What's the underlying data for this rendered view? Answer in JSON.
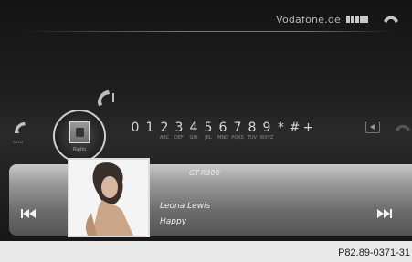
{
  "status": {
    "carrier": "Vodafone.de",
    "signal_bars": 5
  },
  "dialpad": {
    "selected_button_label": "Radio",
    "keys": [
      {
        "char": "0",
        "sub": ""
      },
      {
        "char": "1",
        "sub": ""
      },
      {
        "char": "2",
        "sub": "ABC"
      },
      {
        "char": "3",
        "sub": "DEF"
      },
      {
        "char": "4",
        "sub": "GHI"
      },
      {
        "char": "5",
        "sub": "JKL"
      },
      {
        "char": "6",
        "sub": "MNO"
      },
      {
        "char": "7",
        "sub": "PQRS"
      },
      {
        "char": "8",
        "sub": "TUV"
      },
      {
        "char": "9",
        "sub": "WXYZ"
      },
      {
        "char": "*",
        "sub": ""
      },
      {
        "char": "#",
        "sub": ""
      },
      {
        "char": "+",
        "sub": ""
      }
    ]
  },
  "media": {
    "station": "GT-R300",
    "artist": "Leona Lewis",
    "track": "Happy"
  },
  "figure_code": "P82.89-0371-31",
  "colors": {
    "screen_bg": "#1a1a1a",
    "media_bar": "#8a8a8a",
    "page_bg": "#e9e9e9"
  }
}
